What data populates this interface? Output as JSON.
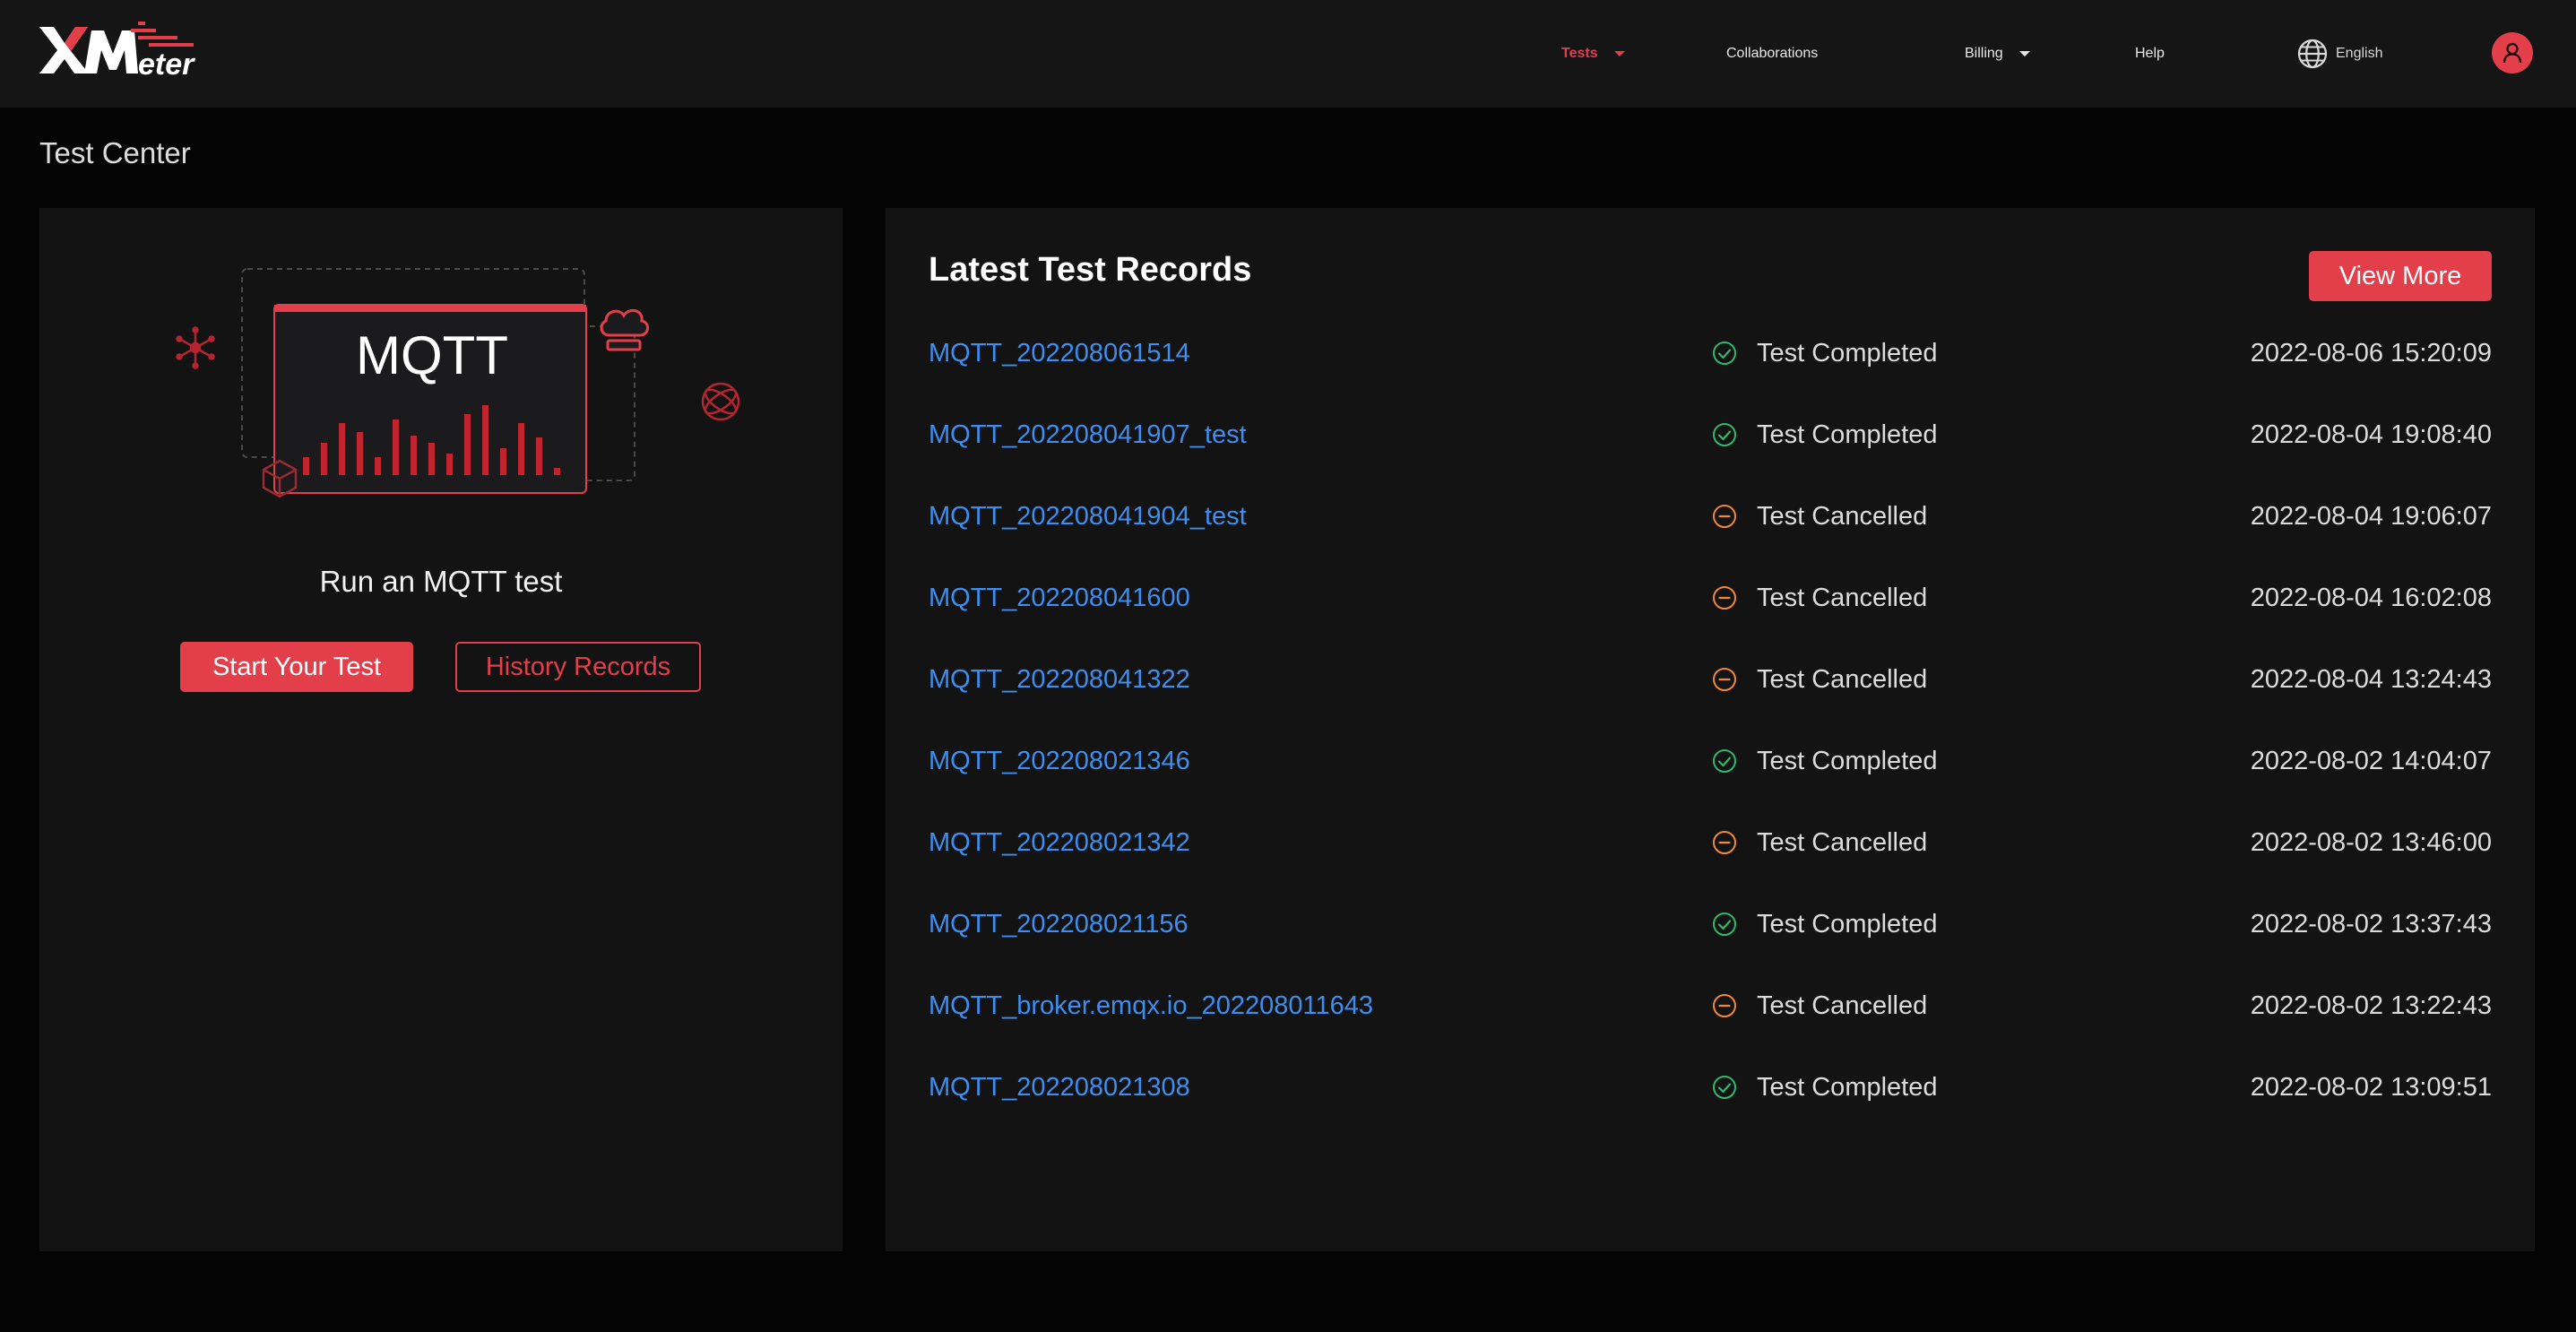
{
  "colors": {
    "accent": "#e23f4b",
    "link": "#3d8ef0",
    "completed": "#2fb86e",
    "cancelled": "#f0883a",
    "background": "#040404",
    "card": "#131313",
    "topbar": "#151515"
  },
  "header": {
    "logo_text": "XMeter",
    "nav": [
      {
        "label": "Tests",
        "active": true,
        "dropdown": true
      },
      {
        "label": "Collaborations",
        "active": false,
        "dropdown": false
      },
      {
        "label": "Billing",
        "active": false,
        "dropdown": true
      },
      {
        "label": "Help",
        "active": false,
        "dropdown": false
      }
    ],
    "language": {
      "icon": "globe-icon",
      "label": "English"
    },
    "avatar_icon": "user-icon"
  },
  "page_title": "Test Center",
  "left_panel": {
    "illustration_label": "MQTT",
    "run_label": "Run an MQTT test",
    "start_button": "Start Your Test",
    "history_button": "History Records"
  },
  "records": {
    "title": "Latest Test Records",
    "view_more": "View More",
    "items": [
      {
        "name": "MQTT_202208061514",
        "status": "Test Completed",
        "status_type": "completed",
        "time": "2022-08-06 15:20:09"
      },
      {
        "name": "MQTT_202208041907_test",
        "status": "Test Completed",
        "status_type": "completed",
        "time": "2022-08-04 19:08:40"
      },
      {
        "name": "MQTT_202208041904_test",
        "status": "Test Cancelled",
        "status_type": "cancelled",
        "time": "2022-08-04 19:06:07"
      },
      {
        "name": "MQTT_202208041600",
        "status": "Test Cancelled",
        "status_type": "cancelled",
        "time": "2022-08-04 16:02:08"
      },
      {
        "name": "MQTT_202208041322",
        "status": "Test Cancelled",
        "status_type": "cancelled",
        "time": "2022-08-04 13:24:43"
      },
      {
        "name": "MQTT_202208021346",
        "status": "Test Completed",
        "status_type": "completed",
        "time": "2022-08-02 14:04:07"
      },
      {
        "name": "MQTT_202208021342",
        "status": "Test Cancelled",
        "status_type": "cancelled",
        "time": "2022-08-02 13:46:00"
      },
      {
        "name": "MQTT_202208021156",
        "status": "Test Completed",
        "status_type": "completed",
        "time": "2022-08-02 13:37:43"
      },
      {
        "name": "MQTT_broker.emqx.io_202208011643",
        "status": "Test Cancelled",
        "status_type": "cancelled",
        "time": "2022-08-02 13:22:43"
      },
      {
        "name": "MQTT_202208021308",
        "status": "Test Completed",
        "status_type": "completed",
        "time": "2022-08-02 13:09:51"
      }
    ]
  }
}
